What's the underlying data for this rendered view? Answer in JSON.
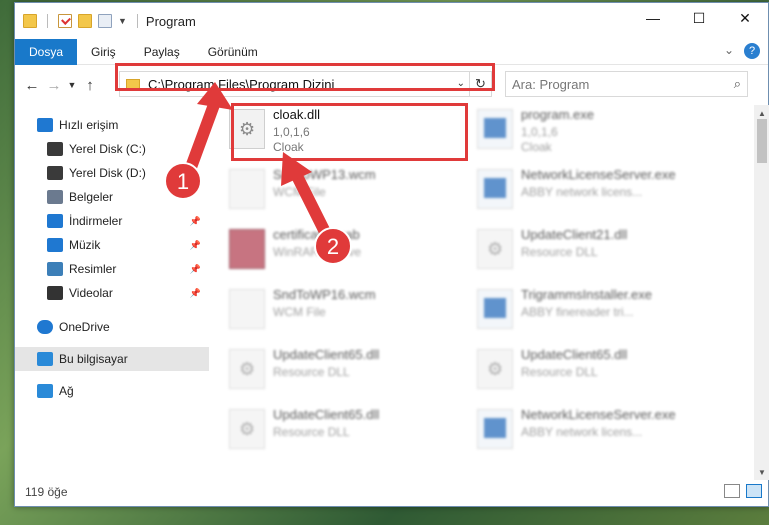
{
  "window": {
    "title": "Program",
    "controls": [
      "—",
      "☐",
      "✕"
    ]
  },
  "ribbon": {
    "tabs": [
      "Dosya",
      "Giriş",
      "Paylaş",
      "Görünüm"
    ]
  },
  "address": {
    "path": "C:\\Program Files\\Program Dizini",
    "search_placeholder": "Ara: Program"
  },
  "sidebar": {
    "items": [
      {
        "label": "Hızlı erişim",
        "icon": "star-icon",
        "color": "#1f78d1",
        "pinned": false
      },
      {
        "label": "Yerel Disk (C:)",
        "icon": "drive-icon",
        "color": "#3a3a3a",
        "pinned": false
      },
      {
        "label": "Yerel Disk (D:)",
        "icon": "drive-icon",
        "color": "#3a3a3a",
        "pinned": false
      },
      {
        "label": "Belgeler",
        "icon": "document-icon",
        "color": "#6b7a8f",
        "pinned": false
      },
      {
        "label": "İndirmeler",
        "icon": "download-icon",
        "color": "#1f78d1",
        "pinned": true
      },
      {
        "label": "Müzik",
        "icon": "music-icon",
        "color": "#1f78d1",
        "pinned": true
      },
      {
        "label": "Resimler",
        "icon": "pictures-icon",
        "color": "#3c7fb8",
        "pinned": true
      },
      {
        "label": "Videolar",
        "icon": "video-icon",
        "color": "#333",
        "pinned": true
      },
      {
        "label": "OneDrive",
        "icon": "cloud-icon",
        "color": "#1f78d1",
        "pinned": false
      },
      {
        "label": "Bu bilgisayar",
        "icon": "computer-icon",
        "color": "#2a8ad8",
        "pinned": false,
        "selected": true
      },
      {
        "label": "Ağ",
        "icon": "network-icon",
        "color": "#2a8ad8",
        "pinned": false
      }
    ]
  },
  "files": [
    {
      "name": "cloak.dll",
      "line2": "1,0,1,6",
      "line3": "Cloak",
      "type": "gear",
      "focus": true
    },
    {
      "name": "program.exe",
      "line2": "1,0,1,6",
      "line3": "Cloak",
      "type": "exe"
    },
    {
      "name": "SndToWP13.wcm",
      "line2": "WCM File",
      "line3": "",
      "type": "plain"
    },
    {
      "name": "NetworkLicenseServer.exe",
      "line2": "ABBY network licens...",
      "line3": "",
      "type": "exe"
    },
    {
      "name": "certificates.cab",
      "line2": "WinRAR archive",
      "line3": "",
      "type": "rar"
    },
    {
      "name": "UpdateClient21.dll",
      "line2": "Resource DLL",
      "line3": "",
      "type": "gear"
    },
    {
      "name": "SndToWP16.wcm",
      "line2": "WCM File",
      "line3": "",
      "type": "plain"
    },
    {
      "name": "TrigrammsInstaller.exe",
      "line2": "ABBY finereader tri...",
      "line3": "",
      "type": "exe"
    },
    {
      "name": "UpdateClient65.dll",
      "line2": "Resource DLL",
      "line3": "",
      "type": "gear"
    },
    {
      "name": "UpdateClient65.dll",
      "line2": "Resource DLL",
      "line3": "",
      "type": "gear"
    },
    {
      "name": "UpdateClient65.dll",
      "line2": "Resource DLL",
      "line3": "",
      "type": "gear"
    },
    {
      "name": "NetworkLicenseServer.exe",
      "line2": "ABBY network licens...",
      "line3": "",
      "type": "exe"
    }
  ],
  "annotations": {
    "step1": "1",
    "step2": "2",
    "color": "#e03a3a"
  },
  "status": {
    "count": "119 öğe"
  }
}
